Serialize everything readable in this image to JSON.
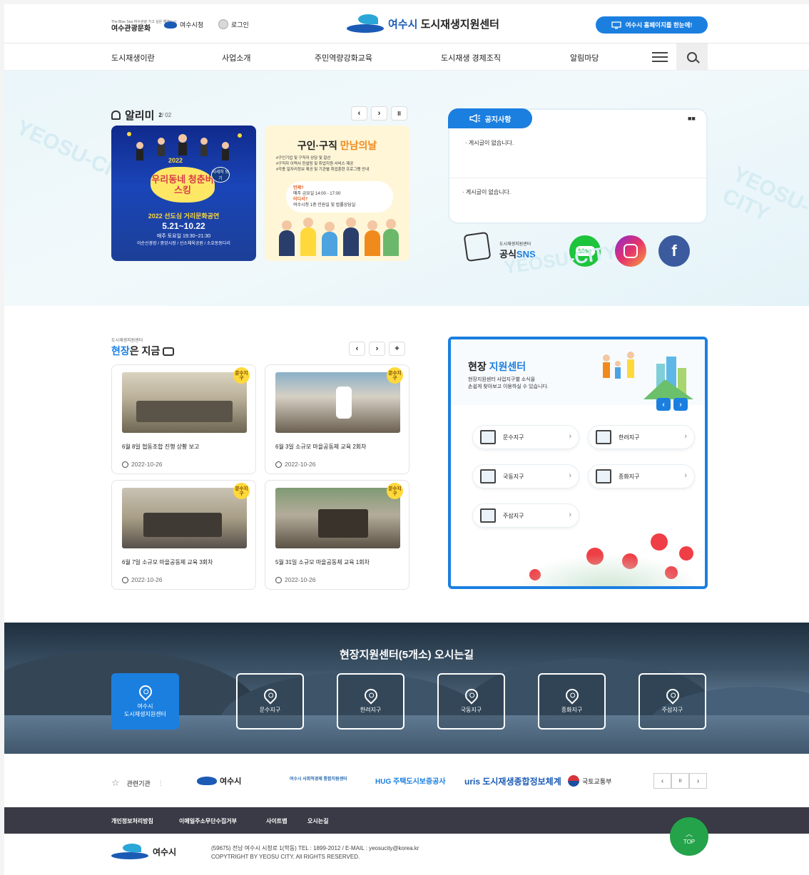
{
  "header": {
    "tour_logo_small": "The Blue Sea 여수관광 가고 싶은 해양도시",
    "tour_logo": "여수관광문화",
    "yeosu_link": "여수시청",
    "login": "로그인",
    "site_logo_prefix": "여수시",
    "site_logo_title": "도시재생지원센터",
    "home_button": "여수시 홈페이지를 한눈에!"
  },
  "nav": {
    "items": [
      "도시재생이란",
      "사업소개",
      "주민역량강화교육",
      "도시재생 경제조직",
      "알림마당"
    ]
  },
  "alrimi": {
    "title": "알리미",
    "page_current": "2",
    "page_total": "/ 02",
    "prev": "‹",
    "next": "›",
    "pause": "II",
    "poster1": {
      "year": "2022",
      "title": "우리동네 청춘버스킹",
      "badge": "자세히 보기",
      "sub": "2022 선도심 거리문화공연",
      "date": "5.21~10.22",
      "time": "매주 토요일 19:30~21:30",
      "place": "이순신광장 / 중앙시장 / 선소체육공원 / 소호동동다리"
    },
    "poster2": {
      "title_a": "구인·구직",
      "title_b": "만남의날",
      "desc1": "#구인기업 및 구직자 상담 및 알선",
      "desc2": "#구직자 이력서 컨설팅 및 취업지원 서비스 제공",
      "desc3": "#각종 일자리정보 제공 및 기관별 취업훈련 프로그램 안내",
      "when_label": "언제?",
      "when": "매주 금요일 14:00 - 17:00",
      "where_label": "어디서?",
      "where": "여수시청 1층 민원실 및 법률상담실"
    }
  },
  "notice": {
    "tab": "공지사항",
    "item1": "게시글이 없습니다.",
    "item2": "게시글이 없습니다."
  },
  "sns": {
    "small": "도시재생지원센터",
    "label_a": "공식",
    "label_b": "SNS",
    "blog": "blog",
    "facebook": "f"
  },
  "field": {
    "sub": "도시재생지원센터",
    "title_a": "현장",
    "title_b": "은 지금",
    "cards": [
      {
        "badge": "문수지구",
        "title": "6월 8일 협동조합 진행 상황 보고",
        "date": "2022-10-26"
      },
      {
        "badge": "문수지구",
        "title": "6월 3일 소규모 마을공동체 교육 2회차",
        "date": "2022-10-26"
      },
      {
        "badge": "문수지구",
        "title": "6월 7일 소규모 마을공동체 교육 3회차",
        "date": "2022-10-26"
      },
      {
        "badge": "문수지구",
        "title": "5월 31일 소규모 마을공동체 교육 1회차",
        "date": "2022-10-26"
      }
    ],
    "prev": "‹",
    "next": "›",
    "more": "+"
  },
  "support": {
    "title_a": "현장",
    "title_b": "지원센터",
    "desc1": "현장지원센터 사업지구별 소식을",
    "desc2": "손쉽게 찾아보고 이용하실 수 있습니다.",
    "areas": [
      "문수지구",
      "한려지구",
      "국동지구",
      "종화지구",
      "주삼지구"
    ]
  },
  "directions": {
    "title": "현장지원센터(5개소) 오시는길",
    "main_line1": "여수시",
    "main_line2": "도시재생지원센터",
    "areas": [
      "문수지구",
      "한려지구",
      "국동지구",
      "종화지구",
      "주삼지구"
    ]
  },
  "related": {
    "label": "관련기관",
    "orgs": [
      "여수시",
      "여수시 사회적경제 통합지원센터",
      "HUG 주택도시보증공사",
      "uris 도시재생종합정보체계",
      "국토교통부"
    ]
  },
  "footer": {
    "links": [
      "개인정보처리방침",
      "이메일주소무단수집거부",
      "사이트맵",
      "오시는길"
    ],
    "top": "TOP",
    "logo": "여수시",
    "address": "(59675) 전남 여수시 시청로 1(학동) TEL : 1899-2012 / E-MAIL : yeosucity@korea.kr",
    "copyright": "COPYTRIGHT BY YEOSU CITY. All RIGHTS RESERVED."
  },
  "colors": {
    "accent": "#1b7fe0",
    "brand": "#1b5bb5",
    "footer_bar": "#393a45",
    "top_button": "#24a34a",
    "badge": "#ffd93b"
  }
}
